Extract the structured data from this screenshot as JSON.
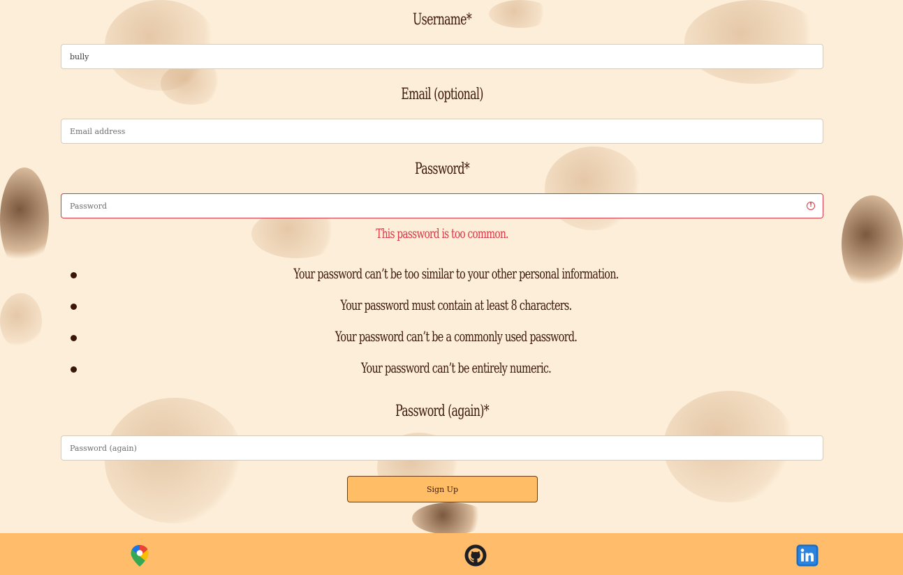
{
  "form": {
    "username": {
      "label": "Username*",
      "value": "bully"
    },
    "email": {
      "label": "Email (optional)",
      "placeholder": "Email address"
    },
    "password": {
      "label": "Password*",
      "placeholder": "Password",
      "error": "This password is too common.",
      "help": [
        "Your password can’t be too similar to your other personal information.",
        "Your password must contain at least 8 characters.",
        "Your password can’t be a commonly used password.",
        "Your password can’t be entirely numeric."
      ]
    },
    "password_again": {
      "label": "Password (again)*",
      "placeholder": "Password (again)"
    },
    "submit_label": "Sign Up"
  },
  "footer": {
    "icons": [
      "google-maps-icon",
      "github-icon",
      "linkedin-icon"
    ]
  },
  "colors": {
    "background": "#fdeed9",
    "footer": "#ffbd6b",
    "button": "#ffbd66",
    "error": "#dc3545",
    "text": "#3a1606"
  }
}
